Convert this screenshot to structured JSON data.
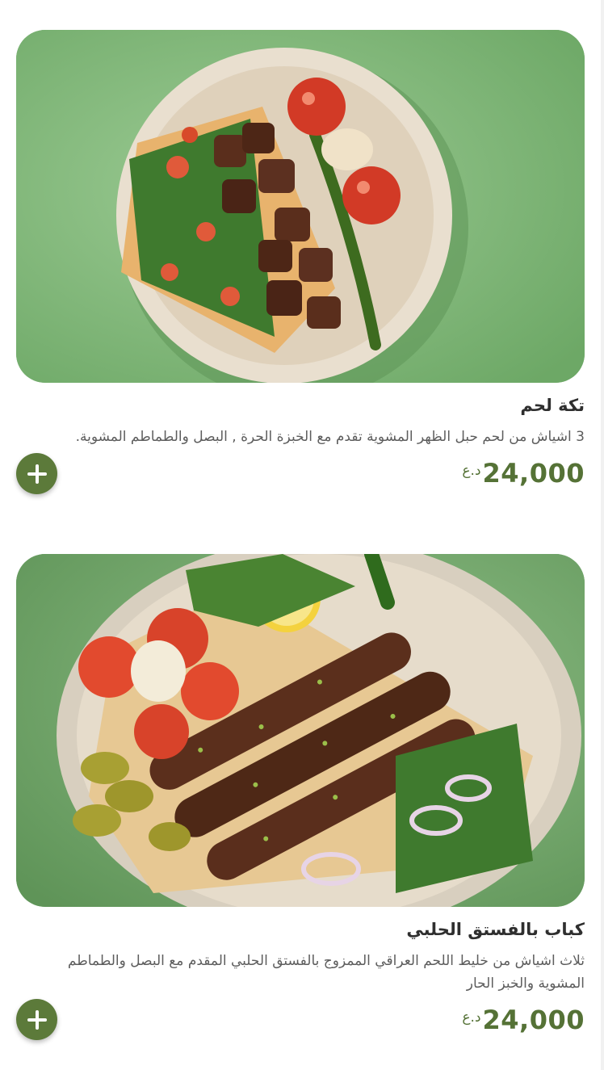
{
  "menu": {
    "items": [
      {
        "name": "تكة لحم",
        "description": "3 اشياش من لحم حبل الظهر المشوية تقدم مع الخبزة الحرة , البصل والطماطم المشوية.",
        "price": "24,000",
        "currency": "د.ع",
        "image": "grilled-meat-tikka-plate"
      },
      {
        "name": "كباب بالفستق الحلبي",
        "description": "ثلاث اشياش من خليط اللحم العراقي الممزوج بالفستق الحلبي المقدم مع البصل والطماطم المشوية والخبز الحار",
        "price": "24,000",
        "currency": "د.ع",
        "image": "pistachio-kebab-plate"
      }
    ]
  },
  "colors": {
    "accent": "#5c7a3a",
    "price": "#557236",
    "photo_background": "#7db37a"
  },
  "icons": {
    "add": "plus-icon"
  }
}
